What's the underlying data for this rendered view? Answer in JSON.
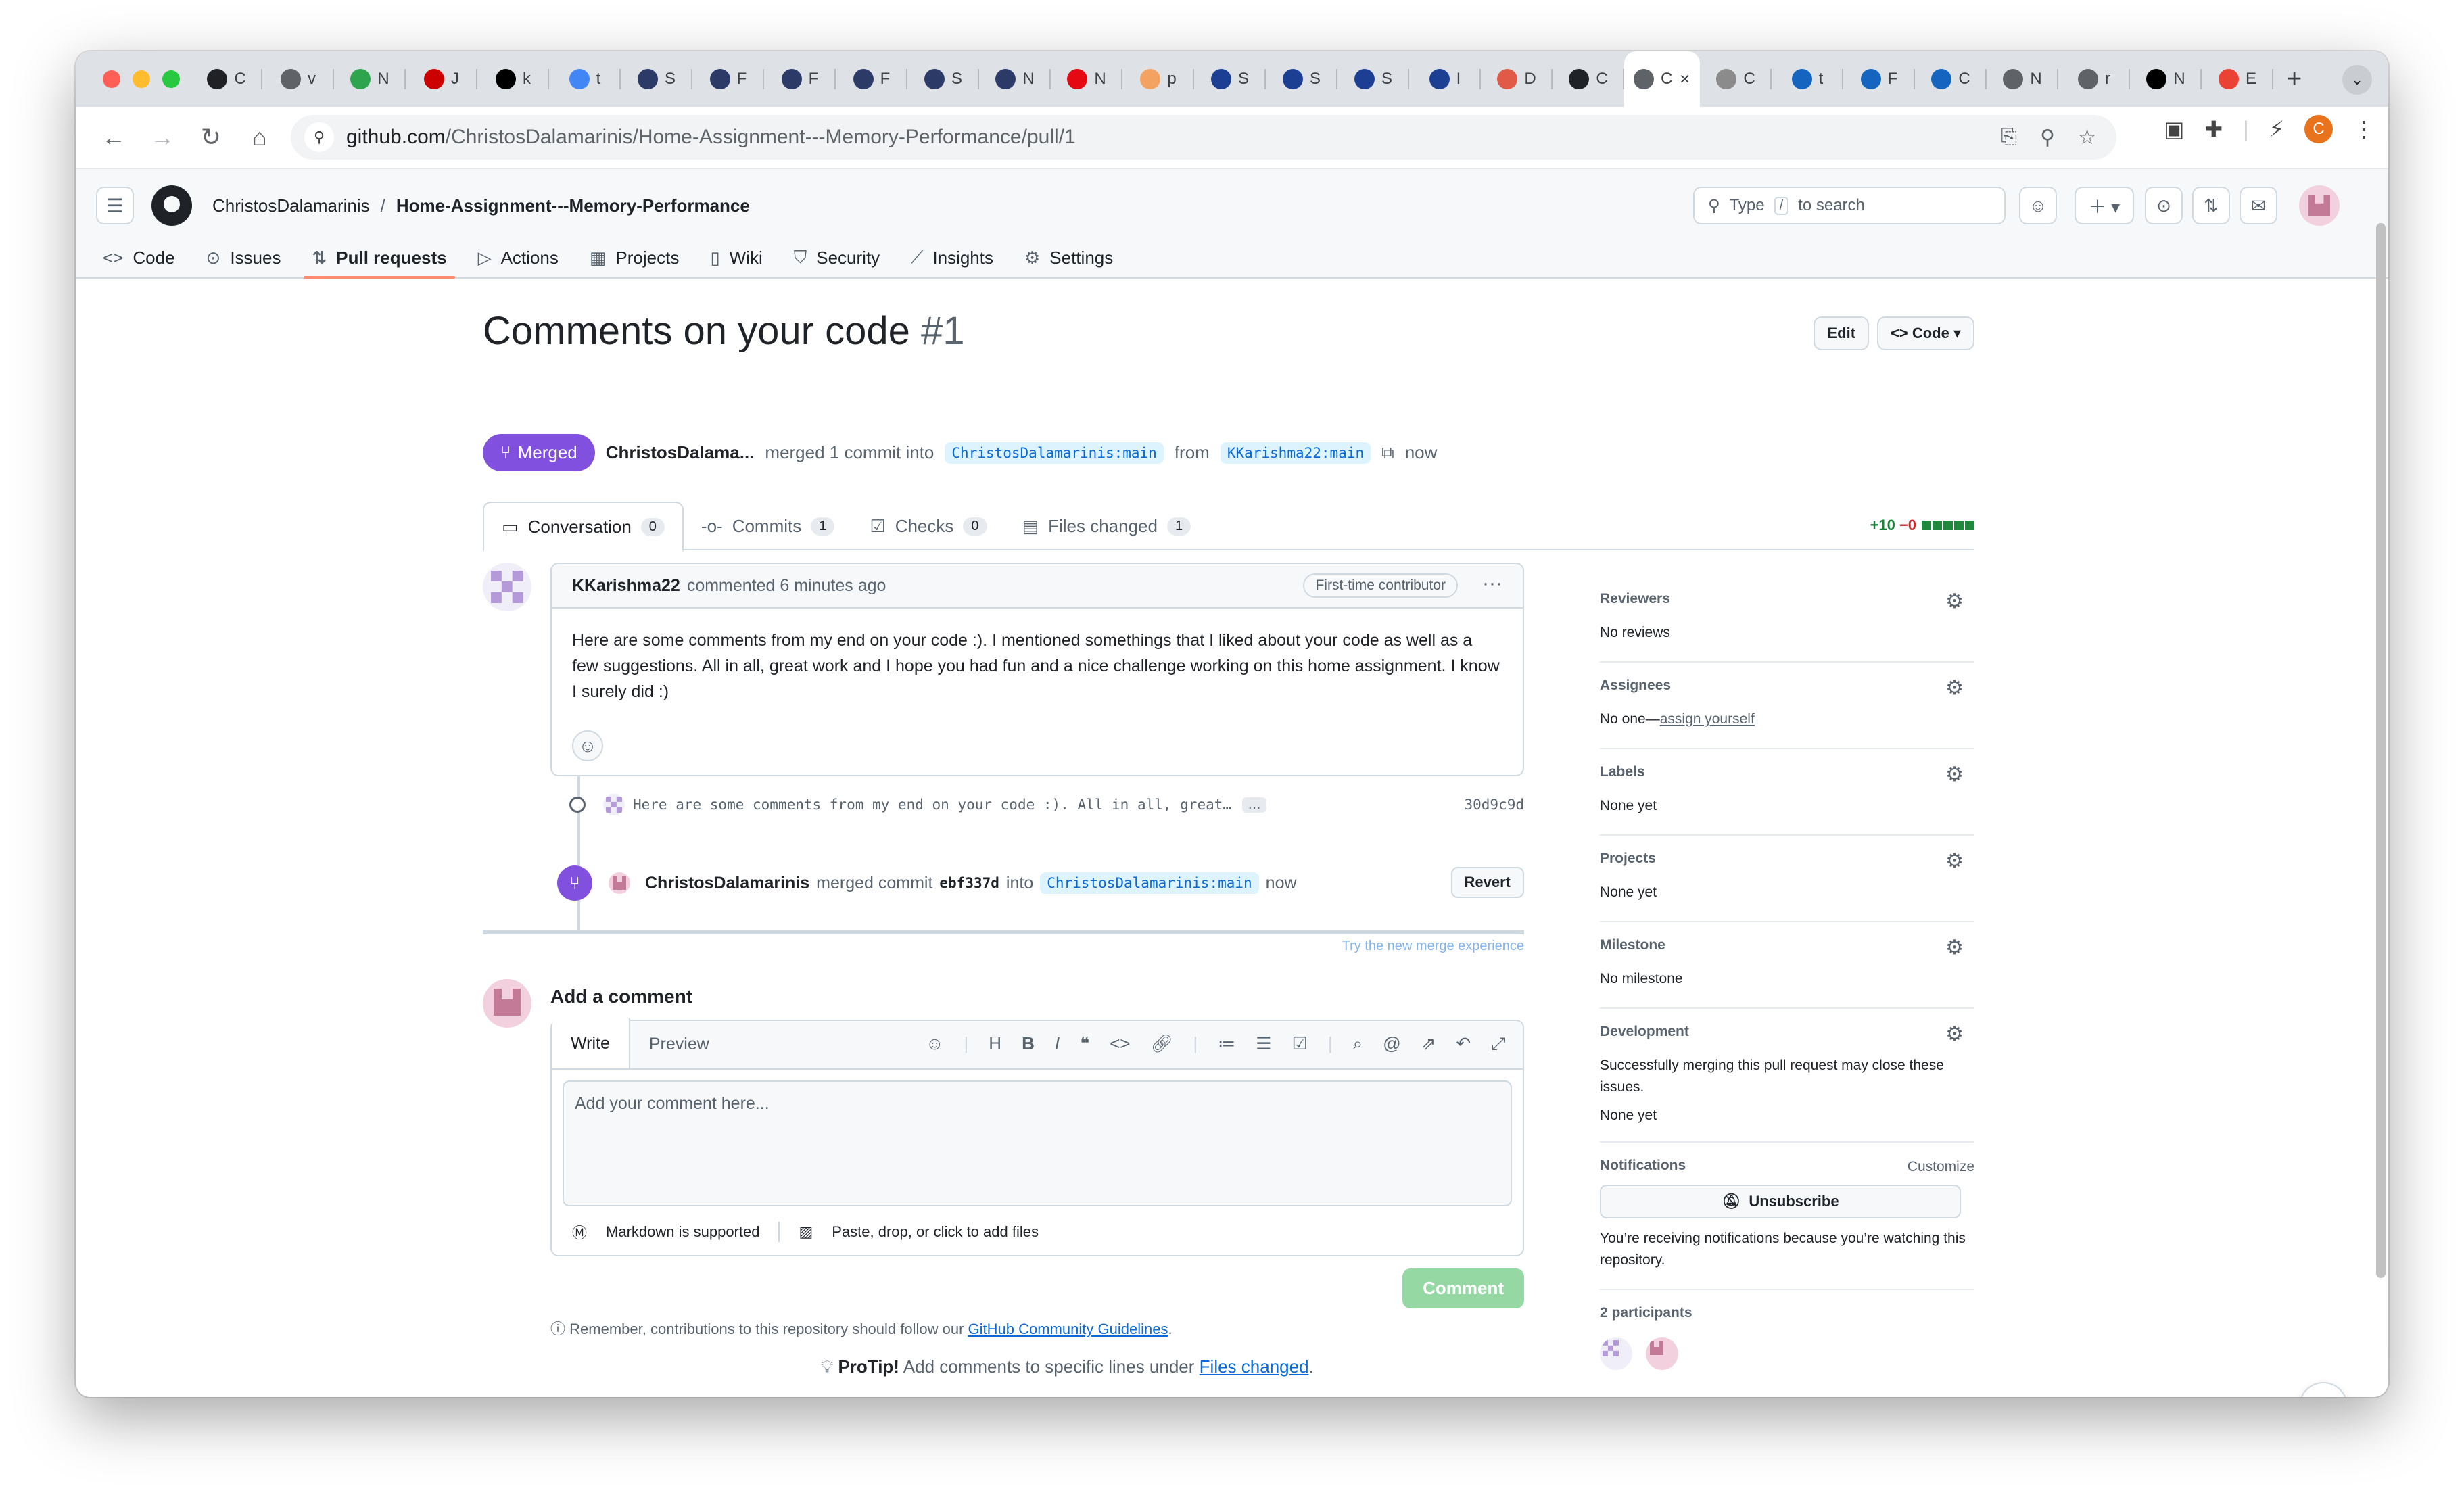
{
  "browser": {
    "tabs": [
      {
        "letter": "C",
        "color": "#202124"
      },
      {
        "letter": "v",
        "color": "#5f6368"
      },
      {
        "letter": "N",
        "color": "#2ea44f"
      },
      {
        "letter": "J",
        "color": "#cc0000"
      },
      {
        "letter": "k",
        "color": "#000000"
      },
      {
        "letter": "t",
        "color": "#4285f4"
      },
      {
        "letter": "S",
        "color": "#2b3a67"
      },
      {
        "letter": "F",
        "color": "#2b3a67"
      },
      {
        "letter": "F",
        "color": "#2b3a67"
      },
      {
        "letter": "F",
        "color": "#2b3a67"
      },
      {
        "letter": "S",
        "color": "#2b3a67"
      },
      {
        "letter": "N",
        "color": "#2b3a67"
      },
      {
        "letter": "N",
        "color": "#e50914"
      },
      {
        "letter": "p",
        "color": "#f4a261"
      },
      {
        "letter": "S",
        "color": "#1c3f94"
      },
      {
        "letter": "S",
        "color": "#1c3f94"
      },
      {
        "letter": "S",
        "color": "#1c3f94"
      },
      {
        "letter": "I",
        "color": "#1c3f94"
      },
      {
        "letter": "D",
        "color": "#e05a47"
      },
      {
        "letter": "C",
        "color": "#1f2328"
      },
      {
        "letter": "C",
        "color": "#5f6368",
        "active": true
      },
      {
        "letter": "C",
        "color": "#8b8b8b"
      },
      {
        "letter": "t",
        "color": "#1565c0"
      },
      {
        "letter": "F",
        "color": "#1565c0"
      },
      {
        "letter": "C",
        "color": "#1565c0"
      },
      {
        "letter": "N",
        "color": "#5f6368"
      },
      {
        "letter": "r",
        "color": "#5f6368"
      },
      {
        "letter": "N",
        "color": "#000000"
      },
      {
        "letter": "E",
        "color": "#ea4335"
      }
    ],
    "new_tab": "+",
    "url_host": "github.com",
    "url_path": "/ChristosDalamarinis/Home-Assignment---Memory-Performance/pull/1",
    "profile_initial": "C"
  },
  "github": {
    "owner": "ChristosDalamarinis",
    "separator": "/",
    "repo": "Home-Assignment---Memory-Performance",
    "search_pre": "Type",
    "search_key": "/",
    "search_post": "to search",
    "repo_nav": [
      {
        "label": "Code",
        "icon": "<>"
      },
      {
        "label": "Issues",
        "icon": "⊙"
      },
      {
        "label": "Pull requests",
        "icon": "⇅",
        "selected": true
      },
      {
        "label": "Actions",
        "icon": "▷"
      },
      {
        "label": "Projects",
        "icon": "▦"
      },
      {
        "label": "Wiki",
        "icon": "▯"
      },
      {
        "label": "Security",
        "icon": "⛉"
      },
      {
        "label": "Insights",
        "icon": "⟋"
      },
      {
        "label": "Settings",
        "icon": "⚙"
      }
    ]
  },
  "pr": {
    "title": "Comments on your code",
    "number": "#1",
    "edit_label": "Edit",
    "code_label": "Code",
    "status": "Merged",
    "author": "ChristosDalama...",
    "merged_text": "merged 1 commit into",
    "base_branch": "ChristosDalamarinis:main",
    "from_text": "from",
    "head_branch": "KKarishma22:main",
    "time": "now",
    "tabs": [
      {
        "label": "Conversation",
        "count": "0",
        "icon": "▭"
      },
      {
        "label": "Commits",
        "count": "1",
        "icon": "-o-"
      },
      {
        "label": "Checks",
        "count": "0",
        "icon": "☑"
      },
      {
        "label": "Files changed",
        "count": "1",
        "icon": "▤"
      }
    ],
    "additions": "+10",
    "deletions": "−0"
  },
  "comment": {
    "author": "KKarishma22",
    "action": "commented 6 minutes ago",
    "badge": "First-time contributor",
    "body": "Here are some comments from my end on your code :). I mentioned somethings that I liked about your code as well as a few suggestions. All in all, great work and I hope you had fun and a nice challenge working on this home assignment. I know I surely did :)"
  },
  "commit": {
    "message": "Here are some comments from my end on your code :). All in all, great…",
    "more": "…",
    "sha": "30d9c9d"
  },
  "merge_event": {
    "who": "ChristosDalamarinis",
    "text": "merged commit",
    "sha": "ebf337d",
    "into": "into",
    "branch": "ChristosDalamarinis:main",
    "time": "now",
    "revert_label": "Revert"
  },
  "try_merge": "Try the new merge experience",
  "add_comment": {
    "title": "Add a comment",
    "write_tab": "Write",
    "preview_tab": "Preview",
    "placeholder": "Add your comment here...",
    "markdown_note": "Markdown is supported",
    "attach_note": "Paste, drop, or click to add files",
    "submit_label": "Comment",
    "remember_text": "Remember, contributions to this repository should follow our",
    "guidelines_link": "GitHub Community Guidelines",
    "protip_label": "ProTip!",
    "protip_text": "Add comments to specific lines under",
    "protip_link": "Files changed"
  },
  "sidebar": {
    "reviewers_title": "Reviewers",
    "reviewers_value": "No reviews",
    "assignees_title": "Assignees",
    "assignees_value": "No one—",
    "assignees_link": "assign yourself",
    "labels_title": "Labels",
    "labels_value": "None yet",
    "projects_title": "Projects",
    "projects_value": "None yet",
    "milestone_title": "Milestone",
    "milestone_value": "No milestone",
    "development_title": "Development",
    "development_desc": "Successfully merging this pull request may close these issues.",
    "development_value": "None yet",
    "notifications_title": "Notifications",
    "customize_label": "Customize",
    "unsubscribe_label": "Unsubscribe",
    "notifications_note": "You’re receiving notifications because you’re watching this repository.",
    "participants_title": "2 participants"
  }
}
